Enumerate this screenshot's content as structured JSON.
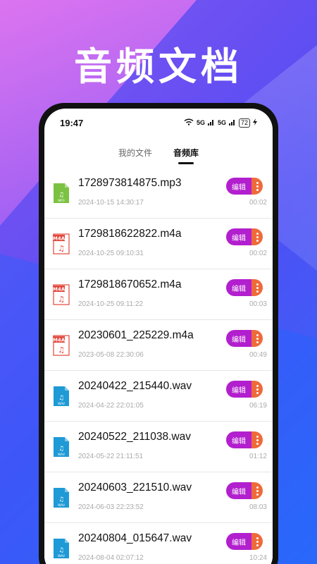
{
  "headline": "音频文档",
  "status": {
    "time": "19:47",
    "signal1": "5G",
    "signal2": "5G",
    "battery": "72"
  },
  "tabs": [
    {
      "label": "我的文件",
      "active": false
    },
    {
      "label": "音频库",
      "active": true
    }
  ],
  "item_actions": {
    "edit_label": "编辑"
  },
  "files": [
    {
      "name": "1728973814875.mp3",
      "date": "2024-10-15 14:30:17",
      "duration": "00:02",
      "type": "mp3",
      "type_label": "MP3"
    },
    {
      "name": "1729818622822.m4a",
      "date": "2024-10-25 09:10:31",
      "duration": "00:02",
      "type": "m4a",
      "type_label": "M4A"
    },
    {
      "name": "1729818670652.m4a",
      "date": "2024-10-25 09:11:22",
      "duration": "00:03",
      "type": "m4a",
      "type_label": "M4A"
    },
    {
      "name": "20230601_225229.m4a",
      "date": "2023-05-08 22:30:06",
      "duration": "00:49",
      "type": "m4a",
      "type_label": "M4A"
    },
    {
      "name": "20240422_215440.wav",
      "date": "2024-04-22 22:01:05",
      "duration": "06:19",
      "type": "wav",
      "type_label": "WAV"
    },
    {
      "name": "20240522_211038.wav",
      "date": "2024-05-22 21:11:51",
      "duration": "01:12",
      "type": "wav",
      "type_label": "WAV"
    },
    {
      "name": "20240603_221510.wav",
      "date": "2024-06-03 22:23:52",
      "duration": "08:03",
      "type": "wav",
      "type_label": "WAV"
    },
    {
      "name": "20240804_015647.wav",
      "date": "2024-08-04 02:07:12",
      "duration": "10:24",
      "type": "wav",
      "type_label": "WAV"
    }
  ],
  "colors": {
    "edit_button": "#b21fce",
    "more_button": "#ef6a3a",
    "mp3_icon": "#7cc242",
    "m4a_icon": "#e2463b",
    "wav_icon": "#1e9ad6"
  }
}
